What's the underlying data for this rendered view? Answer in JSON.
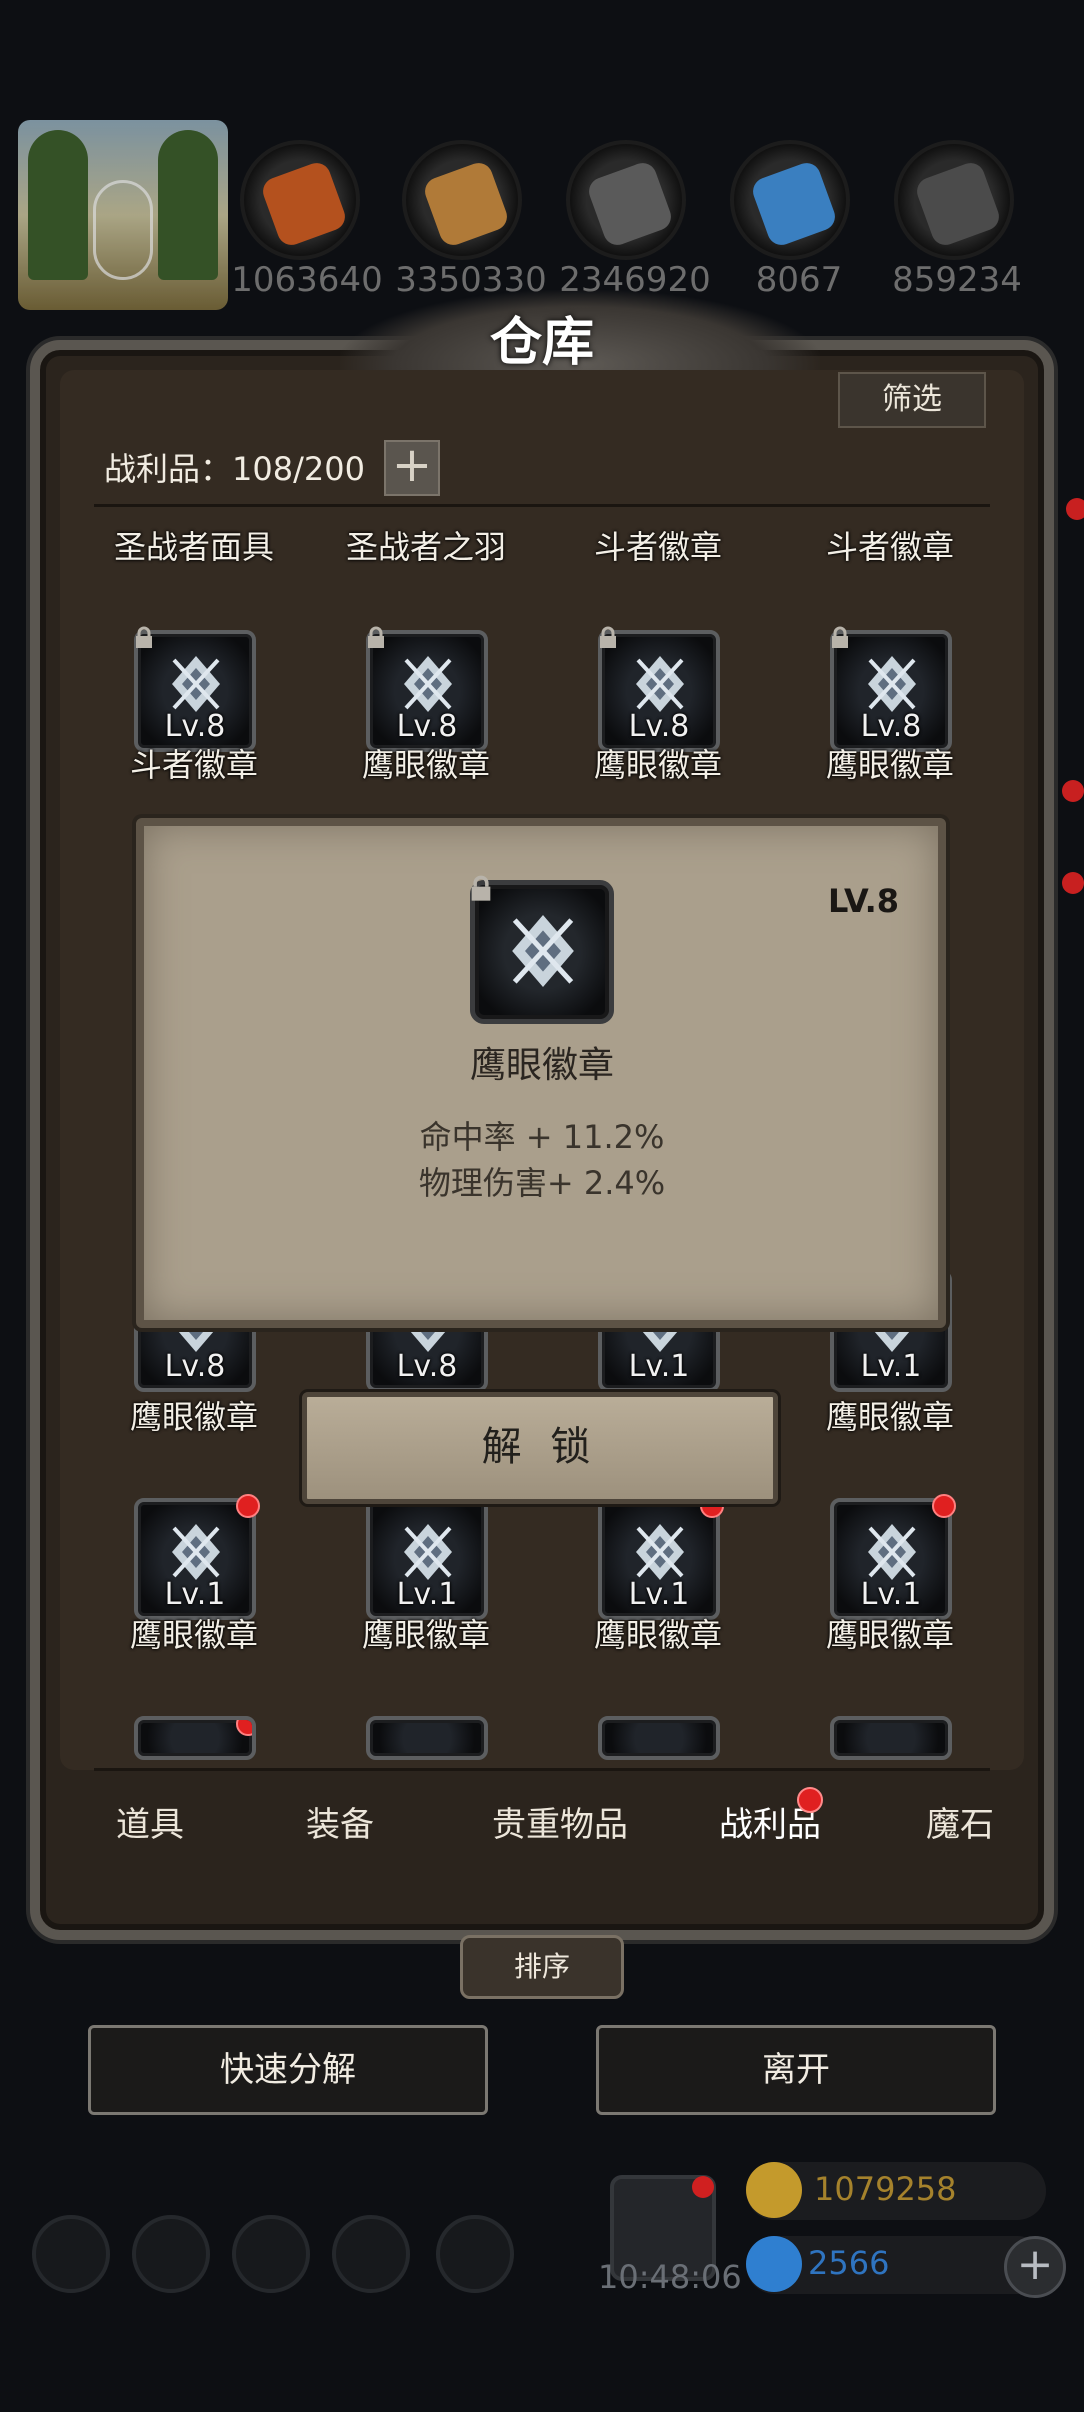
{
  "resources": [
    {
      "name": "meat-icon",
      "value": "1063640",
      "color": "#b4511e"
    },
    {
      "name": "wood-icon",
      "value": "3350330",
      "color": "#b07a38"
    },
    {
      "name": "iron-icon",
      "value": "2346920",
      "color": "#5a5a5a"
    },
    {
      "name": "crystal-icon",
      "value": "8067",
      "color": "#3a7fc0"
    },
    {
      "name": "stone-icon",
      "value": "859234",
      "color": "#4b4b4b"
    }
  ],
  "window": {
    "title": "仓库",
    "filter_label": "筛选",
    "loot_count": "战利品：108/200",
    "plus": "+"
  },
  "grid": {
    "row0": [
      "圣战者面具",
      "圣战者之羽",
      "斗者徽章",
      "斗者徽章"
    ],
    "row1": [
      {
        "level": "Lv.8",
        "name": "斗者徽章"
      },
      {
        "level": "Lv.8",
        "name": "鹰眼徽章"
      },
      {
        "level": "Lv.8",
        "name": "鹰眼徽章"
      },
      {
        "level": "Lv.8",
        "name": "鹰眼徽章"
      }
    ],
    "row2": [
      {
        "level": "Lv.8",
        "name": "鹰眼徽章"
      },
      {
        "level": "Lv.8",
        "name": ""
      },
      {
        "level": "Lv.1",
        "name": ""
      },
      {
        "level": "Lv.1",
        "name": "鹰眼徽章"
      }
    ],
    "row3": [
      {
        "level": "Lv.1",
        "name": "鹰眼徽章"
      },
      {
        "level": "Lv.1",
        "name": "鹰眼徽章"
      },
      {
        "level": "Lv.1",
        "name": "鹰眼徽章"
      },
      {
        "level": "Lv.1",
        "name": "鹰眼徽章"
      }
    ]
  },
  "popup": {
    "level": "LV.8",
    "name": "鹰眼徽章",
    "stat1": "命中率 + 11.2%",
    "stat2": "物理伤害+ 2.4%",
    "unlock_label": "解 锁"
  },
  "tabs": [
    "道具",
    "装备",
    "贵重物品",
    "战利品",
    "魔石"
  ],
  "active_tab": "战利品",
  "sort_label": "排序",
  "quick_decompose_label": "快速分解",
  "leave_label": "离开",
  "hud": {
    "time": "10:48:06",
    "gold": "1079258",
    "diamond": "2566",
    "gold_color": "#c49a2c",
    "diamond_color": "#2f7fd0"
  }
}
